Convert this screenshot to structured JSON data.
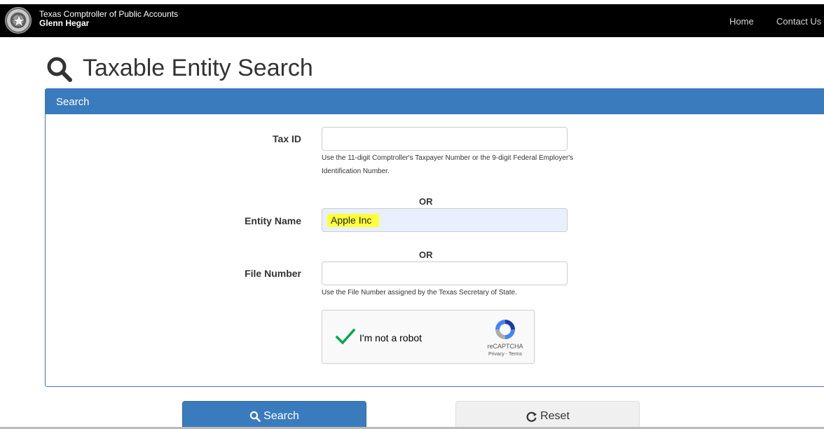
{
  "header": {
    "agency": "Texas Comptroller of Public Accounts",
    "official": "Glenn Hegar",
    "nav": [
      {
        "label": "Home"
      },
      {
        "label": "Contact Us"
      }
    ]
  },
  "page": {
    "title": "Taxable Entity Search",
    "title_icon": "search-icon"
  },
  "panel": {
    "heading": "Search"
  },
  "form": {
    "tax_id": {
      "label": "Tax ID",
      "value": "",
      "hint": "Use the 11-digit Comptroller's Taxpayer Number or the 9-digit Federal Employer's Identification Number."
    },
    "or_1": "OR",
    "entity_name": {
      "label": "Entity Name",
      "value": "Apple Inc"
    },
    "or_2": "OR",
    "file_number": {
      "label": "File Number",
      "value": "",
      "hint": "Use the File Number assigned by the Texas Secretary of State."
    }
  },
  "captcha": {
    "checked": true,
    "label": "I'm not a robot",
    "brand": "reCAPTCHA",
    "links": "Privacy - Terms"
  },
  "buttons": {
    "search": "Search",
    "reset": "Reset"
  },
  "colors": {
    "primary": "#3a7bbd",
    "topbar": "#000000",
    "autofill": "#e8f0fe",
    "highlight": "#ffff3a",
    "check": "#00a651"
  }
}
